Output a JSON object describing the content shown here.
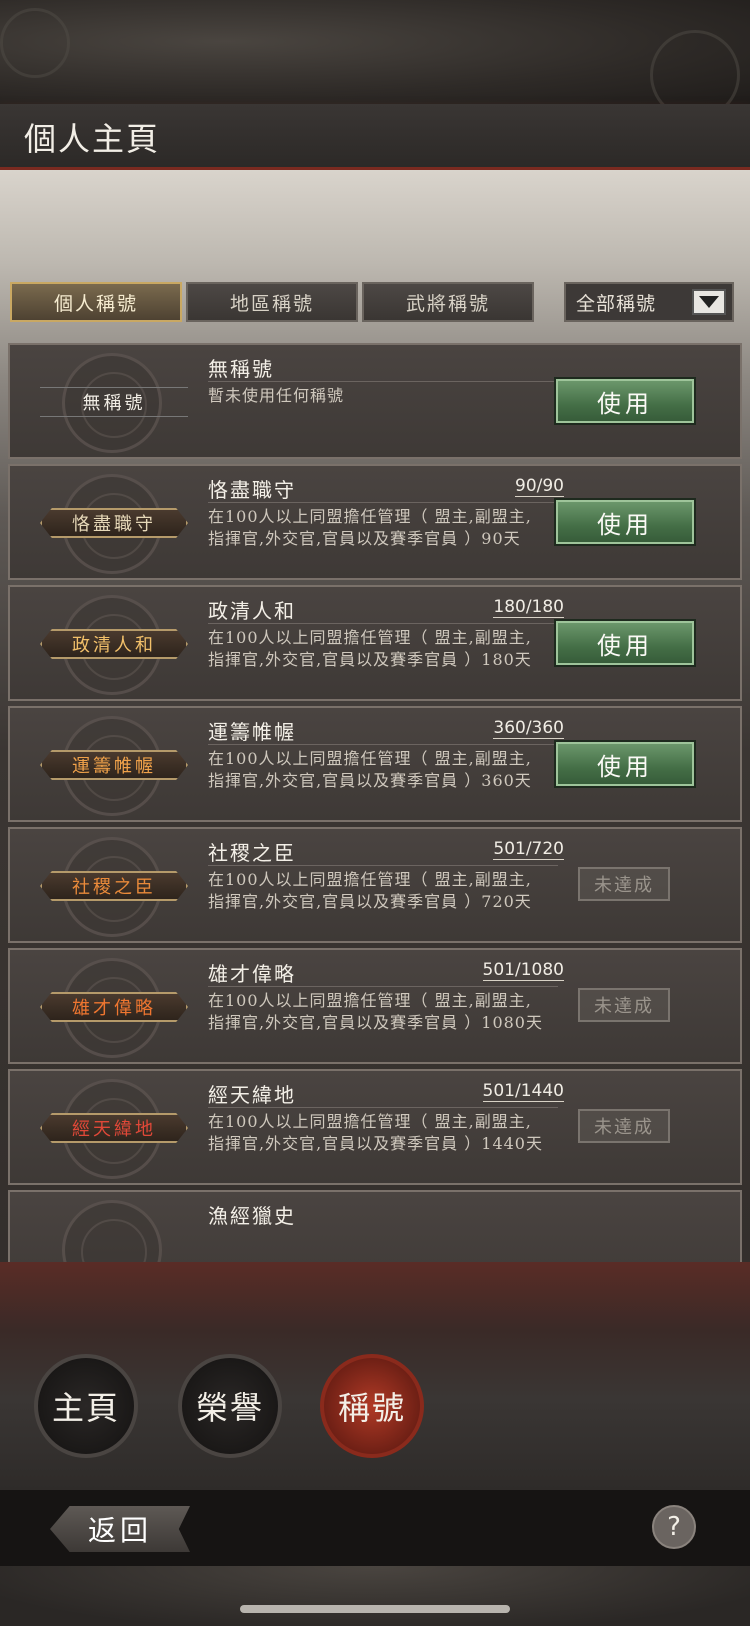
{
  "header": {
    "title": "個人主頁"
  },
  "tabs": [
    {
      "label": "個人稱號"
    },
    {
      "label": "地區稱號"
    },
    {
      "label": "武將稱號"
    }
  ],
  "filter": {
    "label": "全部稱號",
    "icon": "triangle-down-icon"
  },
  "titles": [
    {
      "plate": "無稱號",
      "name": "無稱號",
      "progress": "",
      "desc": "暫未使用任何稱號",
      "action": "使用"
    },
    {
      "plate": "恪盡職守",
      "name": "恪盡職守",
      "progress": "90/90",
      "desc": "在100人以上同盟擔任管理（ 盟主,副盟主,指揮官,外交官,官員以及賽季官員 ）90天",
      "action": "使用"
    },
    {
      "plate": "政清人和",
      "name": "政清人和",
      "progress": "180/180",
      "desc": "在100人以上同盟擔任管理（ 盟主,副盟主,指揮官,外交官,官員以及賽季官員 ）180天",
      "action": "使用"
    },
    {
      "plate": "運籌帷幄",
      "name": "運籌帷幄",
      "progress": "360/360",
      "desc": "在100人以上同盟擔任管理（ 盟主,副盟主,指揮官,外交官,官員以及賽季官員 ）360天",
      "action": "使用"
    },
    {
      "plate": "社稷之臣",
      "name": "社稷之臣",
      "progress": "501/720",
      "desc": "在100人以上同盟擔任管理（ 盟主,副盟主,指揮官,外交官,官員以及賽季官員 ）720天",
      "action": "未達成"
    },
    {
      "plate": "雄才偉略",
      "name": "雄才偉略",
      "progress": "501/1080",
      "desc": "在100人以上同盟擔任管理（ 盟主,副盟主,指揮官,外交官,官員以及賽季官員 ）1080天",
      "action": "未達成"
    },
    {
      "plate": "經天緯地",
      "name": "經天緯地",
      "progress": "501/1440",
      "desc": "在100人以上同盟擔任管理（ 盟主,副盟主,指揮官,外交官,官員以及賽季官員 ）1440天",
      "action": "未達成"
    },
    {
      "plate": "",
      "name": "漁經獵史",
      "progress": "",
      "desc": "",
      "action": ""
    }
  ],
  "nav": [
    {
      "label": "主頁"
    },
    {
      "label": "榮譽"
    },
    {
      "label": "稱號"
    }
  ],
  "footer": {
    "back_label": "返回",
    "help_label": "?"
  },
  "colors": {
    "accent_red": "#b03a26",
    "use_green": "#446e46",
    "gold_border": "#c9a862"
  }
}
